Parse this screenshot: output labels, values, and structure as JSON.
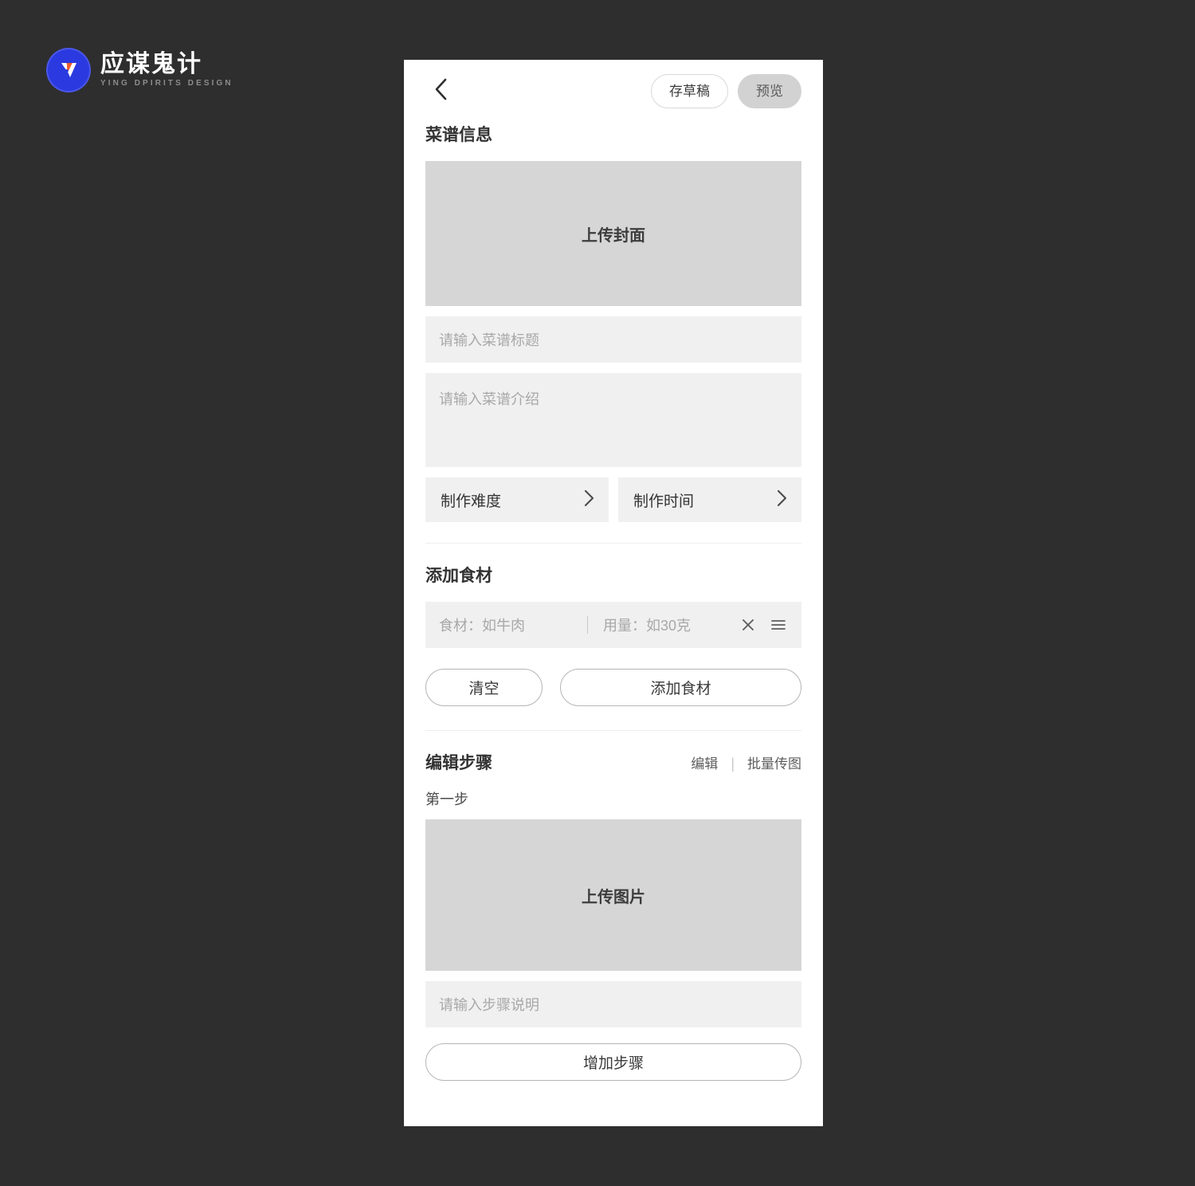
{
  "brand": {
    "title": "应谋鬼计",
    "subtitle": "YING DPIRITS DESIGN"
  },
  "topbar": {
    "back_icon": "chevron-left-icon",
    "save_draft_label": "存草稿",
    "preview_label": "预览"
  },
  "recipe_info": {
    "heading": "菜谱信息",
    "cover_upload_label": "上传封面",
    "title_placeholder": "请输入菜谱标题",
    "intro_placeholder": "请输入菜谱介绍",
    "difficulty_label": "制作难度",
    "time_label": "制作时间",
    "chevron_icon": "chevron-right-icon"
  },
  "ingredients": {
    "heading": "添加食材",
    "name_placeholder": "食材：如牛肉",
    "amount_placeholder": "用量：如30克",
    "remove_icon": "close-icon",
    "drag_icon": "drag-handle-icon",
    "clear_label": "清空",
    "add_label": "添加食材"
  },
  "steps": {
    "heading": "编辑步骤",
    "edit_label": "编辑",
    "separator": "|",
    "batch_upload_label": "批量传图",
    "step_one_label": "第一步",
    "image_upload_label": "上传图片",
    "description_placeholder": "请输入步骤说明",
    "add_step_label": "增加步骤"
  },
  "colors": {
    "canvas_background": "#2e2e2e",
    "phone_background": "#ffffff",
    "upload_block": "#d6d6d6",
    "field_background": "#f0f0f0",
    "placeholder_text": "#a8a8a8",
    "preview_pill": "#d2d2d2",
    "brand_blue": "#2b3ae0",
    "brand_orange": "#f05a28"
  }
}
